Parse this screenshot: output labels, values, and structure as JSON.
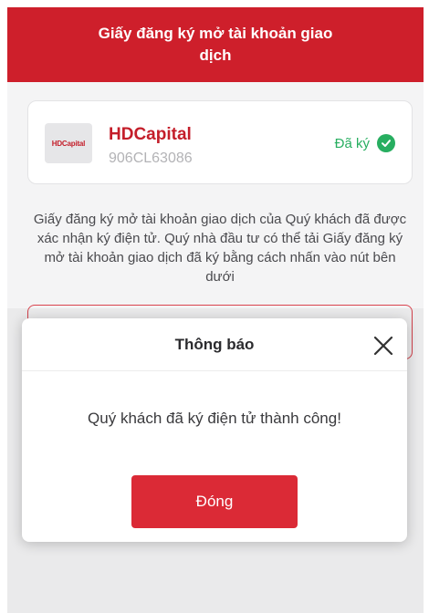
{
  "header": {
    "title": "Giấy đăng ký mở tài khoản giao dịch"
  },
  "broker": {
    "logo": "HDCapital",
    "name": "HDCapital",
    "code": "906CL63086",
    "status": "Đã ký",
    "status_icon": "check-circle-icon"
  },
  "description": "Giấy đăng ký mở tài khoản giao dịch của Quý khách đã được xác nhận ký điện tử. Quý nhà đầu tư có thể tải Giấy đăng ký mở tài khoản giao dịch đã ký bằng cách nhấn vào nút bên dưới",
  "modal": {
    "title": "Thông báo",
    "message": "Quý khách đã ký điện tử thành công!",
    "button": "Đóng",
    "close_icon": "close-icon"
  },
  "colors": {
    "brand": "#ce1f2b",
    "button": "#db2a36",
    "success": "#27ae60"
  }
}
